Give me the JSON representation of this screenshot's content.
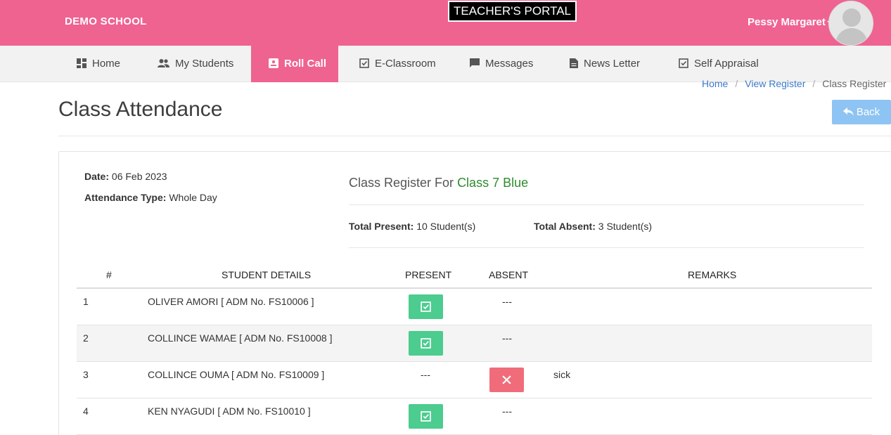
{
  "header": {
    "school_name": "DEMO SCHOOL",
    "portal_label": "TEACHER'S PORTAL",
    "user_name": "Pessy Margaret",
    "brand_color": "#ef6391"
  },
  "nav": {
    "items": [
      {
        "label": "Home",
        "icon": "dashboard-icon"
      },
      {
        "label": "My Students",
        "icon": "people-icon"
      },
      {
        "label": "Roll Call",
        "icon": "roll-call-icon",
        "active": true
      },
      {
        "label": "E-Classroom",
        "icon": "checkbox-icon"
      },
      {
        "label": "Messages",
        "icon": "message-icon"
      },
      {
        "label": "News Letter",
        "icon": "document-icon"
      },
      {
        "label": "Self Appraisal",
        "icon": "checkbox-icon"
      }
    ]
  },
  "breadcrumb": {
    "items": [
      "Home",
      "View Register",
      "Class Register"
    ]
  },
  "page": {
    "title": "Class Attendance",
    "back_label": "Back"
  },
  "register": {
    "date_label": "Date:",
    "date_value": "06 Feb 2023",
    "type_label": "Attendance Type:",
    "type_value": "Whole Day",
    "title_prefix": "Class Register For",
    "class_name": "Class 7 Blue",
    "present_label": "Total Present:",
    "present_value": "10 Student(s)",
    "absent_label": "Total Absent:",
    "absent_value": "3 Student(s)"
  },
  "table": {
    "headers": [
      "#",
      "STUDENT DETAILS",
      "PRESENT",
      "ABSENT",
      "REMARKS"
    ],
    "rows": [
      {
        "num": "1",
        "student": "OLIVER AMORI [ ADM No. FS10006 ]",
        "present": true,
        "present_text": "",
        "absent_text": "---",
        "remarks": ""
      },
      {
        "num": "2",
        "student": "COLLINCE WAMAE [ ADM No. FS10008 ]",
        "present": true,
        "present_text": "",
        "absent_text": "---",
        "remarks": ""
      },
      {
        "num": "3",
        "student": "COLLINCE OUMA [ ADM No. FS10009 ]",
        "present": false,
        "present_text": "---",
        "absent_text": "",
        "remarks": "sick"
      },
      {
        "num": "4",
        "student": "KEN NYAGUDI [ ADM No. FS10010 ]",
        "present": true,
        "present_text": "",
        "absent_text": "---",
        "remarks": ""
      }
    ]
  }
}
